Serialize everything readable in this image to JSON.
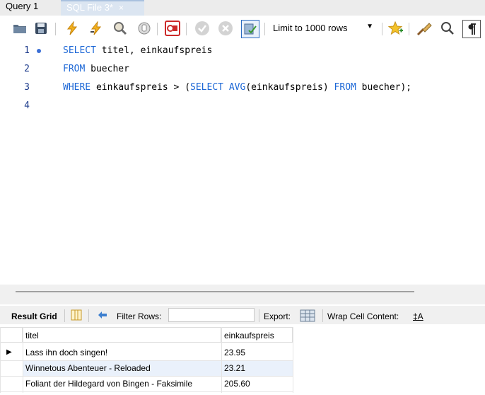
{
  "tabs": [
    {
      "label": "Query 1",
      "active": false
    },
    {
      "label": "SQL File 3*",
      "active": true,
      "close": "×"
    }
  ],
  "toolbar": {
    "icons": [
      "open-folder-icon",
      "save-icon",
      "execute-icon",
      "execute-current-icon",
      "explain-icon",
      "stop-icon",
      "toggle-continue-on-error-icon",
      "commit-icon",
      "rollback-icon",
      "autocommit-icon",
      "add-snippet-icon",
      "beautify-icon",
      "find-icon",
      "invisible-chars-icon"
    ],
    "limit_select": "Limit to 1000 rows",
    "caret": "▼"
  },
  "editor": {
    "lines": [
      {
        "num": "1",
        "has_dot": true
      },
      {
        "num": "2",
        "has_dot": false
      },
      {
        "num": "3",
        "has_dot": false
      },
      {
        "num": "4",
        "has_dot": false
      }
    ],
    "line1": {
      "kw1": "SELECT",
      "rest": " titel, einkaufspreis"
    },
    "line2": {
      "kw1": "FROM",
      "rest": " buecher"
    },
    "line3": {
      "kw1": "WHERE",
      "p1": " einkaufspreis > (",
      "kw2": "SELECT",
      "p2": " ",
      "kw3": "AVG",
      "p3": "(einkaufspreis) ",
      "kw4": "FROM",
      "p4": " buecher);"
    }
  },
  "results_toolbar": {
    "result_grid": "Result Grid",
    "filter_rows": "Filter Rows:",
    "filter_value": "",
    "export": "Export:",
    "wrap": "Wrap Cell Content:",
    "wrap_icon_text": "‡A"
  },
  "grid": {
    "columns": [
      "titel",
      "einkaufspreis"
    ],
    "rows": [
      {
        "titel": "Lass ihn doch singen!",
        "einkaufspreis": "23.95",
        "pointer": "▶"
      },
      {
        "titel": "Winnetous Abenteuer - Reloaded",
        "einkaufspreis": "23.21",
        "pointer": ""
      },
      {
        "titel": "Foliant der Hildegard von Bingen - Faksimile",
        "einkaufspreis": "205.60",
        "pointer": ""
      }
    ]
  },
  "colors": {
    "keyword": "#1c67d6",
    "line_number": "#1e3c8c",
    "selected_row": "#eaf1fb"
  }
}
